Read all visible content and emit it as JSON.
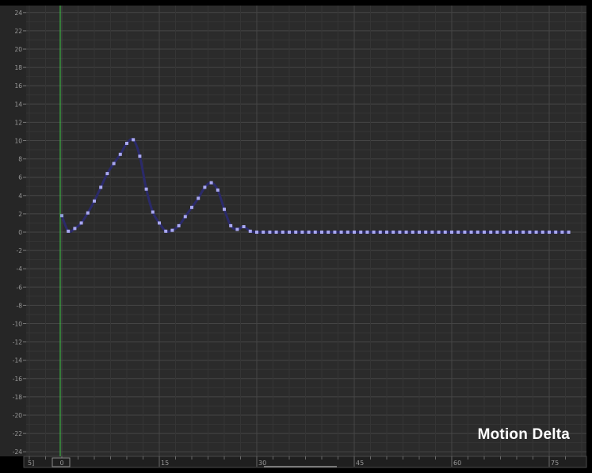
{
  "editor": {
    "title": "Motion Delta",
    "frame_start_label": "5]",
    "current_frame_label": "0"
  },
  "colors": {
    "background": "#2b2b2b",
    "grid_minor": "#353535",
    "grid_major": "#464646",
    "curve": "#2b2a6a",
    "key": "#a9a8f0",
    "playhead": "#3cb043",
    "label": "#9a9a9a"
  },
  "chart_data": {
    "type": "line",
    "title": "Motion Delta",
    "xlim": [
      0,
      77
    ],
    "ylim": [
      -24,
      24
    ],
    "x_ticks": [
      0,
      15,
      30,
      45,
      60,
      75
    ],
    "y_ticks": [
      24,
      22,
      20,
      18,
      16,
      14,
      12,
      10,
      8,
      6,
      4,
      2,
      0,
      -2,
      -4,
      -6,
      -8,
      -10,
      -12,
      -14,
      -16,
      -18,
      -20,
      -22,
      -24
    ],
    "grid": true,
    "series": [
      {
        "x": [
          0,
          1,
          2,
          3,
          4,
          5,
          6,
          7,
          8,
          9,
          10,
          11,
          12,
          13,
          14,
          15,
          16,
          17,
          18,
          19,
          20,
          21,
          22,
          23,
          24,
          25,
          26,
          27,
          28,
          29,
          30,
          31,
          32,
          33,
          34,
          35,
          36,
          37,
          38,
          39,
          40,
          41,
          42,
          43,
          44,
          45,
          46,
          47,
          48,
          49,
          50,
          51,
          52,
          53,
          54,
          55,
          56,
          57,
          58,
          59,
          60,
          61,
          62,
          63,
          64,
          65,
          66,
          67,
          68,
          69,
          70,
          71,
          72,
          73,
          74,
          75,
          76,
          77,
          78
        ],
        "y": [
          1.8,
          0.1,
          0.4,
          1.0,
          2.1,
          3.4,
          4.9,
          6.4,
          7.5,
          8.5,
          9.7,
          10.1,
          8.3,
          4.7,
          2.2,
          1.0,
          0.1,
          0.2,
          0.7,
          1.7,
          2.7,
          3.7,
          4.9,
          5.4,
          4.6,
          2.5,
          0.7,
          0.3,
          0.6,
          0.1,
          0,
          0,
          0,
          0,
          0,
          0,
          0,
          0,
          0,
          0,
          0,
          0,
          0,
          0,
          0,
          0,
          0,
          0,
          0,
          0,
          0,
          0,
          0,
          0,
          0,
          0,
          0,
          0,
          0,
          0,
          0,
          0,
          0,
          0,
          0,
          0,
          0,
          0,
          0,
          0,
          0,
          0,
          0,
          0,
          0,
          0,
          0,
          0,
          0
        ]
      }
    ],
    "current_frame": 0
  }
}
